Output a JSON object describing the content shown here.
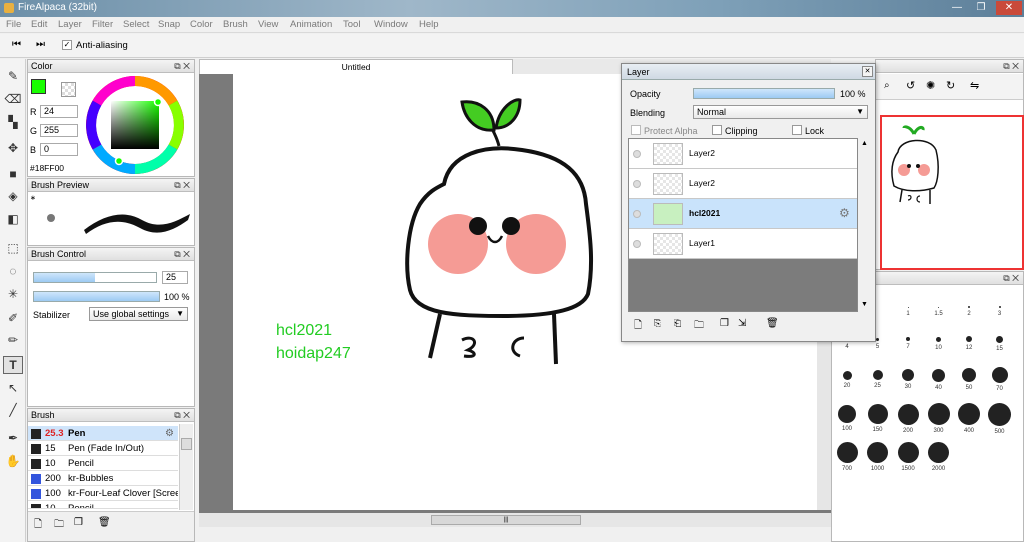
{
  "app": {
    "title": "FireAlpaca (32bit)"
  },
  "menu": [
    "File",
    "Edit",
    "Layer",
    "Filter",
    "Select",
    "Snap",
    "Color",
    "Brush",
    "View",
    "Animation",
    "Tool",
    "Window",
    "Help"
  ],
  "toolbar": {
    "antialias_label": "Anti-aliasing",
    "antialias_checked": true
  },
  "color_panel": {
    "title": "Color",
    "r_label": "R",
    "r": "24",
    "g_label": "G",
    "g": "255",
    "b_label": "B",
    "b": "0",
    "hex": "#18FF00",
    "color": "#18FF00"
  },
  "brush_preview": {
    "title": "Brush Preview",
    "marker": "∗"
  },
  "brush_control": {
    "title": "Brush Control",
    "size": "25",
    "size_fraction": 0.5,
    "opacity": "100 %",
    "opacity_fraction": 1.0,
    "stabilizer_label": "Stabilizer",
    "stabilizer_value": "Use global settings"
  },
  "brush_list": {
    "title": "Brush",
    "items": [
      {
        "size": "25.3",
        "name": "Pen",
        "color": "#222222",
        "selected": true
      },
      {
        "size": "15",
        "name": "Pen (Fade In/Out)",
        "color": "#222222"
      },
      {
        "size": "10",
        "name": "Pencil",
        "color": "#222222"
      },
      {
        "size": "200",
        "name": "kr-Bubbles",
        "color": "#3355dd"
      },
      {
        "size": "100",
        "name": "kr-Four-Leaf Clover [Screen",
        "color": "#3355dd"
      },
      {
        "size": "10",
        "name": "Pencil",
        "color": "#222222"
      }
    ]
  },
  "canvas": {
    "tab": "Untitled",
    "text1": "hcl2021",
    "text2": "hoidap247",
    "text_color": "#22cc22"
  },
  "layer_panel": {
    "title": "Layer",
    "opacity_label": "Opacity",
    "opacity": "100 %",
    "blending_label": "Blending",
    "blending": "Normal",
    "protect_alpha": "Protect Alpha",
    "clipping": "Clipping",
    "lock": "Lock",
    "layers": [
      {
        "name": "Layer2"
      },
      {
        "name": "Layer2"
      },
      {
        "name": "hcl2021",
        "selected": true
      },
      {
        "name": "Layer1"
      }
    ]
  },
  "brush_sizes": {
    "labels": [
      "1",
      "1.5",
      "2",
      "3",
      "4",
      "5",
      "7",
      "10",
      "12",
      "15",
      "20",
      "25",
      "30",
      "40",
      "50",
      "70",
      "100",
      "150",
      "200",
      "300",
      "400",
      "500",
      "700",
      "1000",
      "1500",
      "2000"
    ]
  }
}
